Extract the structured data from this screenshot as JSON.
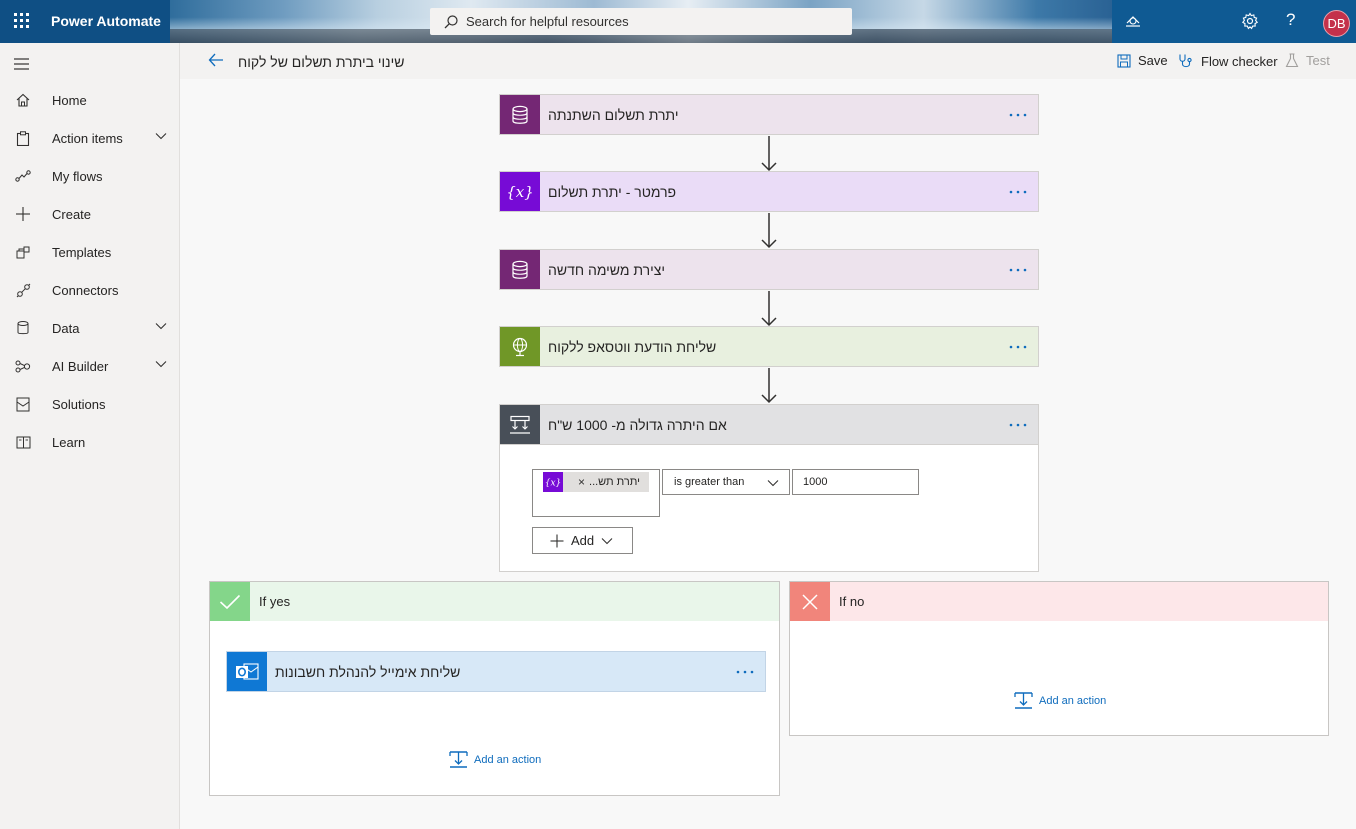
{
  "app": {
    "name": "Power Automate",
    "search_placeholder": "Search for helpful resources",
    "user_initials": "DB",
    "help_label": "?"
  },
  "sidebar": {
    "items": [
      {
        "label": "Home",
        "icon": "home-icon",
        "expandable": false
      },
      {
        "label": "Action items",
        "icon": "clipboard-icon",
        "expandable": true
      },
      {
        "label": "My flows",
        "icon": "flows-icon",
        "expandable": false
      },
      {
        "label": "Create",
        "icon": "plus-icon",
        "expandable": false
      },
      {
        "label": "Templates",
        "icon": "templates-icon",
        "expandable": false
      },
      {
        "label": "Connectors",
        "icon": "connectors-icon",
        "expandable": false
      },
      {
        "label": "Data",
        "icon": "database-icon",
        "expandable": true
      },
      {
        "label": "AI Builder",
        "icon": "ai-builder-icon",
        "expandable": true
      },
      {
        "label": "Solutions",
        "icon": "solutions-icon",
        "expandable": false
      },
      {
        "label": "Learn",
        "icon": "book-icon",
        "expandable": false
      }
    ]
  },
  "commandbar": {
    "flow_title": "שינוי ביתרת תשלום של לקוח",
    "save_label": "Save",
    "checker_label": "Flow checker",
    "test_label": "Test"
  },
  "flow": {
    "steps": [
      {
        "title": "יתרת תשלום השתנתה",
        "icon": "dataverse-icon",
        "icon_bg": "#742774",
        "card_bg": "#ede3ed"
      },
      {
        "title": "פרמטר - יתרת תשלום",
        "icon": "variable-icon",
        "icon_bg": "#770bd6",
        "card_bg": "#eadcf7"
      },
      {
        "title": "יצירת משימה חדשה",
        "icon": "dataverse-icon",
        "icon_bg": "#742774",
        "card_bg": "#ede3ed"
      },
      {
        "title": "שליחת הודעת ווטסאפ ללקוח",
        "icon": "http-globe-icon",
        "icon_bg": "#709727",
        "card_bg": "#e8f0df"
      }
    ],
    "condition": {
      "title": "אם היתרה גדולה מ- 1000 ש\"ח",
      "icon_bg": "#484f58",
      "card_bg": "#e1e1e3",
      "token_label": "יתרת תש...",
      "operator": "is greater than",
      "value": "1000",
      "add_label": "Add"
    },
    "if_yes": {
      "label": "If yes",
      "head_bg": "#e9f6ea",
      "icon_bg": "#84d68a",
      "action": {
        "title": "שליחת אימייל להנהלת חשבונות",
        "icon": "outlook-icon",
        "icon_bg": "#0f78d4",
        "card_bg": "#d7e8f7"
      },
      "add_action_label": "Add an action"
    },
    "if_no": {
      "label": "If no",
      "head_bg": "#fde7e9",
      "icon_bg": "#f1857b",
      "add_action_label": "Add an action"
    }
  },
  "colors": {
    "accent": "#0f6cbd",
    "topbar": "#0f4f84"
  }
}
